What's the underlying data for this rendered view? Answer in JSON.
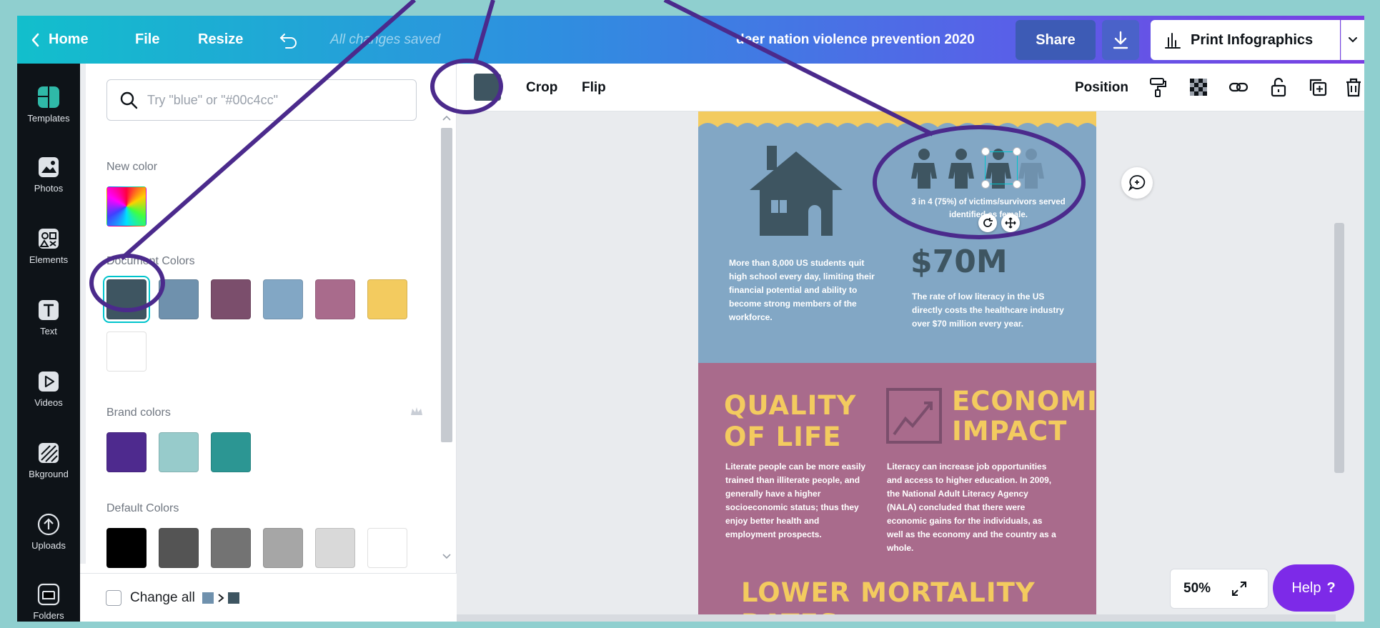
{
  "topbar": {
    "home_label": "Home",
    "file_label": "File",
    "resize_label": "Resize",
    "saved_status": "All changes saved",
    "doc_title": "deer nation violence prevention 2020",
    "share_label": "Share",
    "print_label": "Print Infographics"
  },
  "rail": {
    "items": [
      {
        "label": "Templates",
        "icon": "templates-icon"
      },
      {
        "label": "Photos",
        "icon": "photos-icon"
      },
      {
        "label": "Elements",
        "icon": "elements-icon"
      },
      {
        "label": "Text",
        "icon": "text-icon"
      },
      {
        "label": "Videos",
        "icon": "videos-icon"
      },
      {
        "label": "Bkground",
        "icon": "background-icon"
      },
      {
        "label": "Uploads",
        "icon": "uploads-icon"
      },
      {
        "label": "Folders",
        "icon": "folders-icon"
      }
    ]
  },
  "panel": {
    "search_placeholder": "Try \"blue\" or \"#00c4cc\"",
    "new_color_label": "New color",
    "document_colors_label": "Document Colors",
    "document_colors": [
      "#3e5561",
      "#6f91ad",
      "#7b4e6c",
      "#82a7c5",
      "#a96b8c",
      "#f3cb5f",
      "#ffffff"
    ],
    "brand_colors_label": "Brand colors",
    "brand_colors": [
      "#4e2a8e",
      "#97cbcb",
      "#2c9693"
    ],
    "default_colors_label": "Default Colors",
    "default_colors": [
      "#000000",
      "#545454",
      "#737373",
      "#a6a6a6",
      "#d9d9d9",
      "#ffffff"
    ],
    "default_colors_row2": [
      "#ff1616",
      "#ff5757",
      "#ff66c4",
      "#cb6ce6",
      "#8c52ff",
      "#5e17eb"
    ],
    "change_all_label": "Change all"
  },
  "toolbar": {
    "swatch_color": "#3e5561",
    "crop_label": "Crop",
    "flip_label": "Flip",
    "position_label": "Position"
  },
  "infographic": {
    "stat1_caption": "3 in 4 (75%) of victims/survivors served identified as female.",
    "students_text": "More than 8,000 US students quit high school every day, limiting their financial potential and ability to become strong members of the workforce.",
    "stat2_value": "$70M",
    "stat2_text": "The rate of low literacy in the US directly costs the healthcare industry over $70 million every year.",
    "quality_title_1": "QUALITY",
    "quality_title_2": "OF LIFE",
    "quality_text": "Literate people can be more easily trained than illiterate people, and generally have a higher socioeconomic status; thus they enjoy better health and employment prospects.",
    "economic_title_1": "ECONOMIC",
    "economic_title_2": "IMPACT",
    "economic_text": "Literacy can increase job opportunities and access to higher education. In 2009, the National Adult Literacy Agency (NALA) concluded that there were economic gains for the individuals, as well as the economy and the country as a whole.",
    "mortality_title": "LOWER MORTALITY RATES"
  },
  "footer": {
    "zoom": "50%",
    "help_label": "Help",
    "help_glyph": "?"
  },
  "colors": {
    "annotation": "#4b2a8c",
    "accent": "#00c4cc"
  }
}
